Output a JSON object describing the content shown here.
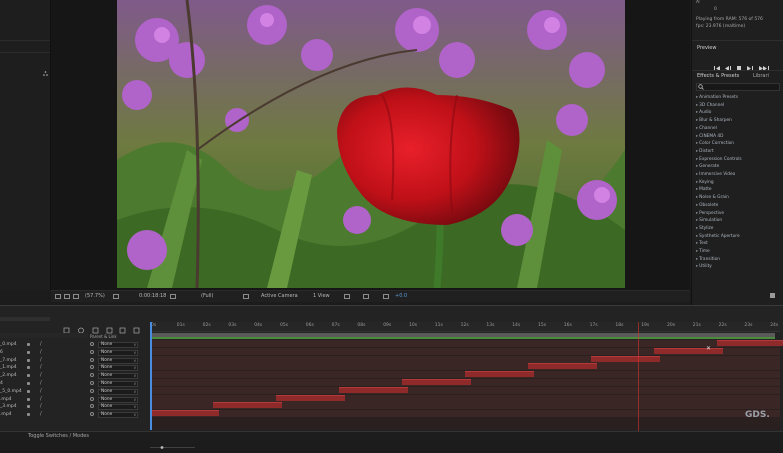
{
  "right_panel": {
    "info_lines": [
      "Playing from RAM: 576 of 576",
      "fps: 23.976 (realtime)"
    ],
    "info_top": [
      "A:",
      "0"
    ],
    "preview_title": "Preview",
    "effects_tab": "Effects & Presets",
    "libraries_tab": "Librari",
    "effects": [
      "Animation Presets",
      "3D Channel",
      "Audio",
      "Blur & Sharpen",
      "Channel",
      "CINEMA 4D",
      "Color Correction",
      "Distort",
      "Expression Controls",
      "Generate",
      "Immersive Video",
      "Keying",
      "Matte",
      "Noise & Grain",
      "Obsolete",
      "Perspective",
      "Simulation",
      "Stylize",
      "Synthetic Aperture",
      "Text",
      "Time",
      "Transition",
      "Utility"
    ]
  },
  "viewer_toolbar": {
    "zoom": "(57.7%)",
    "timecode": "0:00:18:18",
    "resolution": "(Full)",
    "camera": "Active Camera",
    "views": "1 View",
    "exposure": "+0.0"
  },
  "timeline": {
    "parent_header": "Parent & Link",
    "layers": [
      {
        "name": "_0.mp4",
        "parent": "None"
      },
      {
        "name": "6",
        "parent": "None"
      },
      {
        "name": "_7.mp4",
        "parent": "None"
      },
      {
        "name": "_1.mp4",
        "parent": "None"
      },
      {
        "name": "_2.mp4",
        "parent": "None"
      },
      {
        "name": "4",
        "parent": "None"
      },
      {
        "name": "_5_0.mp4",
        "parent": "None"
      },
      {
        "name": ".mp4",
        "parent": "None"
      },
      {
        "name": "_3.mp4",
        "parent": "None"
      },
      {
        "name": ".mp4",
        "parent": "None"
      }
    ],
    "ruler_labels": [
      "0s",
      "01s",
      "02s",
      "03s",
      "04s",
      "05s",
      "06s",
      "07s",
      "08s",
      "09s",
      "10s",
      "11s",
      "12s",
      "13s",
      "14s",
      "15s",
      "16s",
      "17s",
      "18s",
      "19s",
      "20s",
      "21s",
      "22s",
      "23s",
      "24s"
    ],
    "footer": "Toggle Switches / Modes",
    "watermark": "GDS."
  }
}
